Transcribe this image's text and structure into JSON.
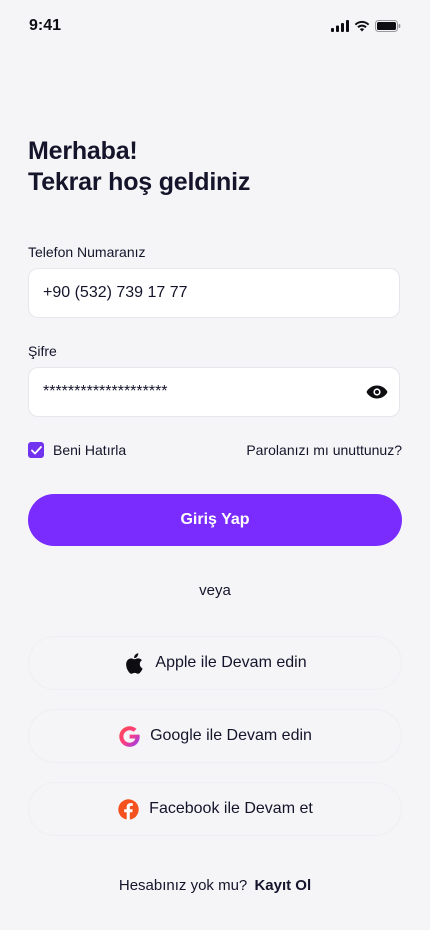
{
  "status_bar": {
    "time": "9:41"
  },
  "header": {
    "line1": "Merhaba!",
    "line2": "Tekrar hoş geldiniz"
  },
  "form": {
    "phone_label": "Telefon Numaranız",
    "phone_value": "+90 (532) 739 17 77",
    "password_label": "Şifre",
    "password_value": "********************",
    "remember_label": "Beni Hatırla",
    "remember_checked": true,
    "forgot_label": "Parolanızı mı unuttunuz?",
    "login_label": "Giriş Yap"
  },
  "divider": {
    "label": "veya"
  },
  "social": {
    "apple_label": "Apple ile Devam edin",
    "google_label": "Google ile Devam edin",
    "facebook_label": "Facebook ile Devam et"
  },
  "footer": {
    "question": "Hesabınız yok mu?",
    "signup_label": "Kayıt Ol"
  },
  "icons": {
    "eye": "eye-icon",
    "check": "check-icon",
    "apple": "apple-icon",
    "google": "google-icon",
    "facebook": "facebook-icon"
  },
  "colors": {
    "primary": "#7a2cff",
    "checkbox": "#7233f0",
    "background": "#f5f5f7",
    "text": "#14142b",
    "facebook": "#f4511e"
  }
}
